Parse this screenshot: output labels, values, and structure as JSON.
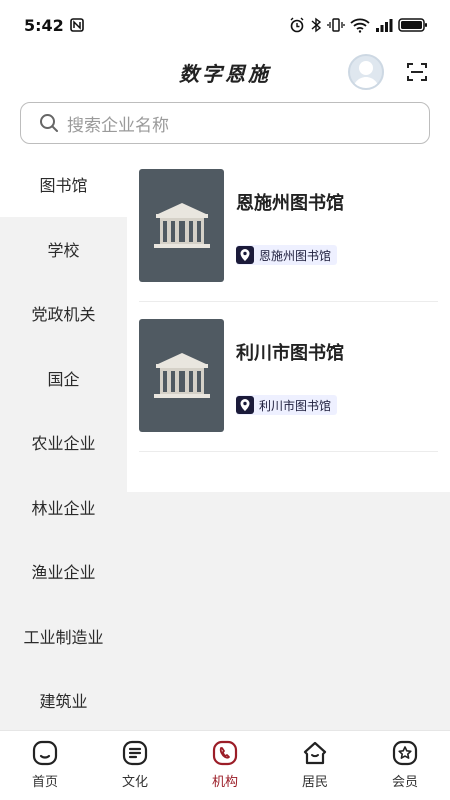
{
  "status_bar": {
    "time": "5:42",
    "battery": "full"
  },
  "header": {
    "title": "数字恩施"
  },
  "search": {
    "placeholder": "搜索企业名称"
  },
  "categories": [
    {
      "label": "图书馆",
      "active": true
    },
    {
      "label": "学校"
    },
    {
      "label": "党政机关"
    },
    {
      "label": "国企"
    },
    {
      "label": "农业企业"
    },
    {
      "label": "林业企业"
    },
    {
      "label": "渔业企业"
    },
    {
      "label": "工业制造业"
    },
    {
      "label": "建筑业"
    }
  ],
  "organizations": [
    {
      "name": "恩施州图书馆",
      "tag": "恩施州图书馆"
    },
    {
      "name": "利川市图书馆",
      "tag": "利川市图书馆"
    }
  ],
  "bottom_nav": [
    {
      "label": "首页",
      "icon": "home-icon"
    },
    {
      "label": "文化",
      "icon": "culture-icon"
    },
    {
      "label": "机构",
      "icon": "institution-icon",
      "active": true
    },
    {
      "label": "居民",
      "icon": "residents-icon"
    },
    {
      "label": "会员",
      "icon": "member-icon"
    }
  ],
  "colors": {
    "accent": "#9b1d27",
    "sidebar_bg": "#f2f2f2",
    "tag_bg": "#eef0ff",
    "thumb_bg": "#505a62"
  }
}
